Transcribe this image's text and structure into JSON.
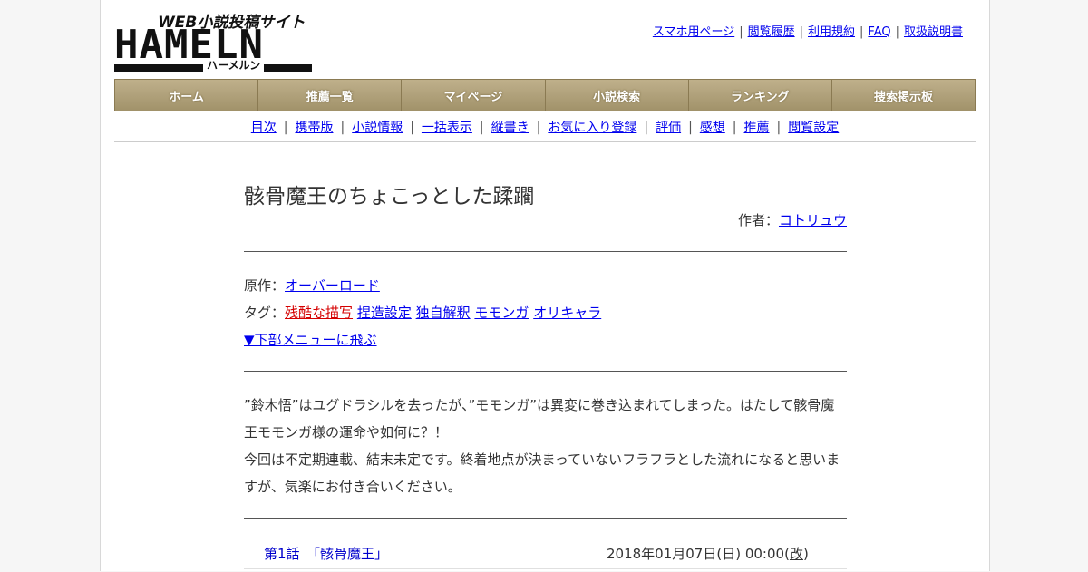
{
  "logo": {
    "tagline": "WEB小説投稿サイト",
    "word": "HAMELN",
    "kana": "ハーメルン"
  },
  "toplinks": [
    "スマホ用ページ",
    "閲覧履歴",
    "利用規約",
    "FAQ",
    "取扱説明書"
  ],
  "main_nav": [
    "ホーム",
    "推薦一覧",
    "マイページ",
    "小説検索",
    "ランキング",
    "捜索掲示板"
  ],
  "sub_nav": [
    "目次",
    "携帯版",
    "小説情報",
    "一括表示",
    "縦書き",
    "お気に入り登録",
    "評価",
    "感想",
    "推薦",
    "閲覧設定"
  ],
  "novel": {
    "title": "骸骨魔王のちょこっとした蹂躙",
    "author_label": "作者：",
    "author": "コトリュウ",
    "original_label": "原作：",
    "original": "オーバーロード",
    "tags_label": "タグ：",
    "tags": [
      "残酷な描写",
      "捏造設定",
      "独自解釈",
      "モモンガ",
      "オリキャラ"
    ],
    "jump_link": "▼下部メニューに飛ぶ",
    "description": [
      "”鈴木悟”はユグドラシルを去ったが、”モモンガ”は異変に巻き込まれてしまった。はたして骸骨魔王モモンガ様の運命や如何に？！",
      "今回は不定期連載、結末未定です。終着地点が決まっていないフラフラとした流れになると思いますが、気楽にお付き合いください。"
    ]
  },
  "chapters": [
    {
      "label": "第1話　「骸骨魔王」",
      "date": "2018年01月07日(日) 00:00",
      "revised": "改"
    }
  ],
  "colors": {
    "nav_gold": "#a1926a",
    "link": "#0000ee",
    "tag_warning": "#d50000"
  }
}
